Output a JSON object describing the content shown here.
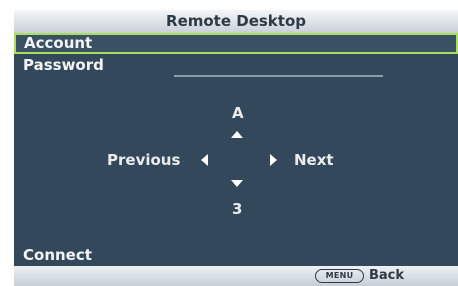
{
  "window": {
    "title": "Remote Desktop"
  },
  "form": {
    "account_label": "Account",
    "password_label": "Password",
    "password_value": ""
  },
  "keypad": {
    "char_above": "A",
    "char_below": "3",
    "previous_label": "Previous",
    "next_label": "Next"
  },
  "actions": {
    "connect_label": "Connect"
  },
  "footer": {
    "menu_key": "MENU",
    "back_label": "Back"
  },
  "colors": {
    "panel_background": "#33495b",
    "selection_border": "#a6e05a",
    "title_bar": "#dfe4e9",
    "text": "#f2f4f6"
  },
  "icons": {
    "up": "triangle-up-icon",
    "down": "triangle-down-icon",
    "left": "triangle-left-icon",
    "right": "triangle-right-icon"
  }
}
